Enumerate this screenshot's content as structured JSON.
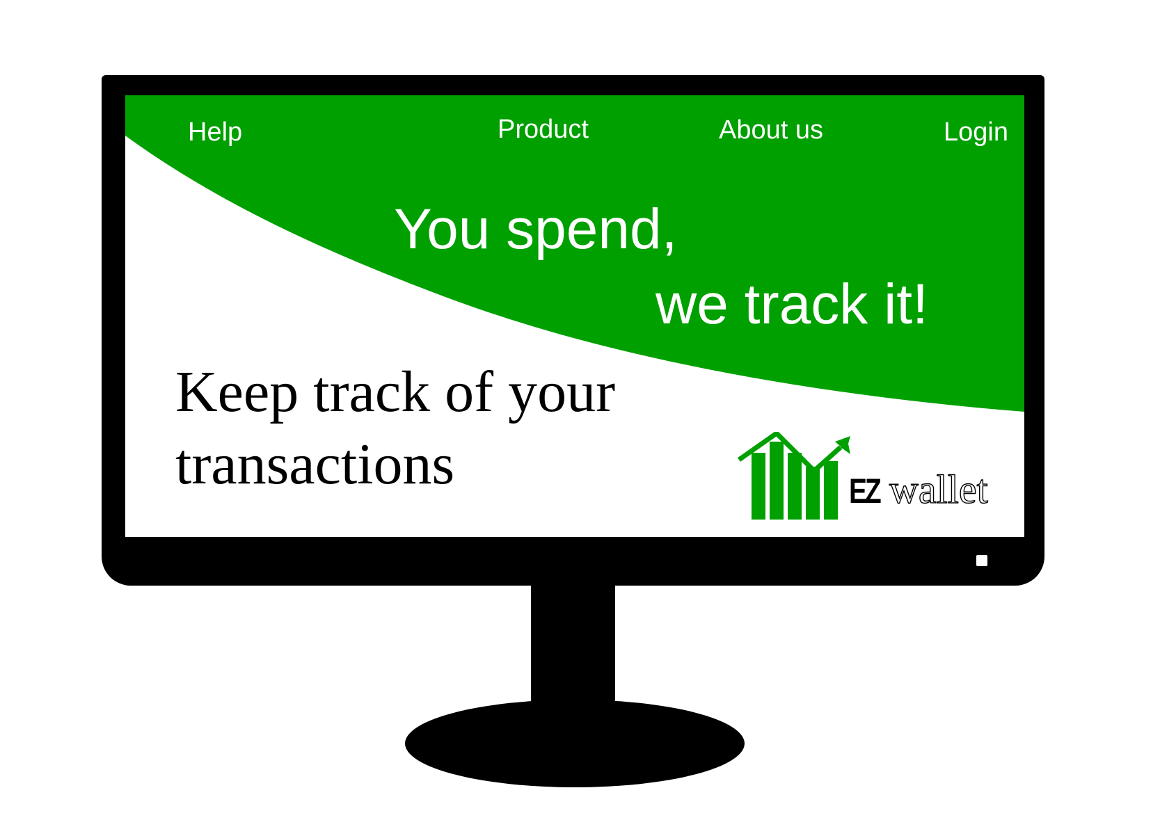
{
  "nav": {
    "help_label": "Help",
    "product_label": "Product",
    "about_label": "About us",
    "login_label": "Login"
  },
  "hero": {
    "line1": "You spend,",
    "line2": "we track it!"
  },
  "tagline": {
    "line1": "Keep track of your",
    "line2": "transactions"
  },
  "logo": {
    "ez": "EZ",
    "wallet": "wallet",
    "icon": "bar-chart-growth-icon"
  },
  "colors": {
    "brand_green": "#00a000",
    "monitor": "#000000",
    "screen_bg": "#ffffff"
  }
}
